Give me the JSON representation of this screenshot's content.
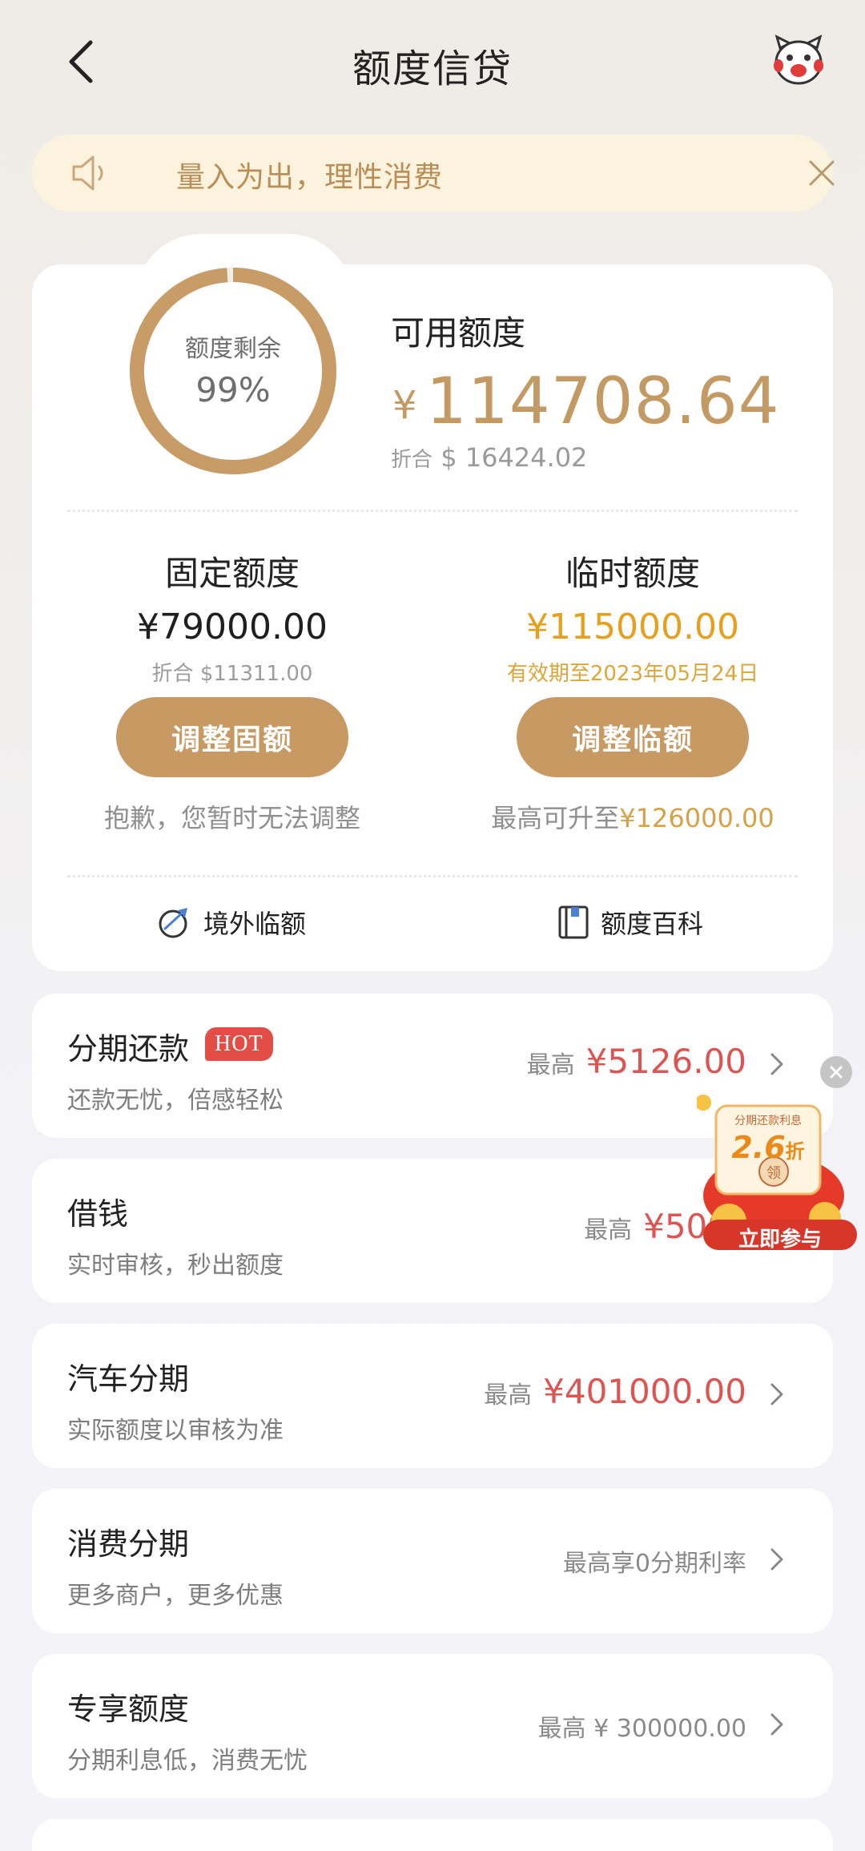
{
  "header": {
    "title": "额度信贷"
  },
  "notice": {
    "text": "量入为出，理性消费"
  },
  "summary": {
    "ring_label": "额度剩余",
    "ring_percent_text": "99%",
    "remaining_fraction": 0.99,
    "available_label": "可用额度",
    "currency_symbol": "¥",
    "available_amount": "114708.64",
    "usd_prefix": "折合",
    "usd_amount": "$ 16424.02"
  },
  "fixed_limit": {
    "title": "固定额度",
    "amount": "¥79000.00",
    "usd": "折合 $11311.00",
    "button": "调整固额",
    "note": "抱歉，您暂时无法调整"
  },
  "temp_limit": {
    "title": "临时额度",
    "amount": "¥115000.00",
    "validity": "有效期至2023年05月24日",
    "button": "调整临额",
    "note_prefix": "最高可升至",
    "note_amount": "¥126000.00"
  },
  "links": {
    "overseas": "境外临额",
    "encyclopedia": "额度百科"
  },
  "products": [
    {
      "title": "分期还款",
      "badge": "HOT",
      "subtitle": "还款无忧，倍感轻松",
      "prefix": "最高",
      "amount": "¥5126.00"
    },
    {
      "title": "借钱",
      "subtitle": "实时审核，秒出额度",
      "prefix": "最高",
      "amount": "¥500"
    },
    {
      "title": "汽车分期",
      "subtitle": "实际额度以审核为准",
      "prefix": "最高",
      "amount": "¥401000.00"
    },
    {
      "title": "消费分期",
      "subtitle": "更多商户，更多优惠",
      "text": "最高享0分期利率"
    },
    {
      "title": "专享额度",
      "subtitle": "分期利息低，消费无忧",
      "text": "最高 ¥ 300000.00"
    }
  ],
  "promo": {
    "tag": "分期还款利息",
    "discount": "2.6",
    "discount_unit": "折",
    "coin": "领",
    "cta": "立即参与"
  },
  "colors": {
    "accent_gold": "#c79a64",
    "temp_orange": "#e6a020",
    "price_red": "#dc5552",
    "hot_red": "#e24d45"
  }
}
